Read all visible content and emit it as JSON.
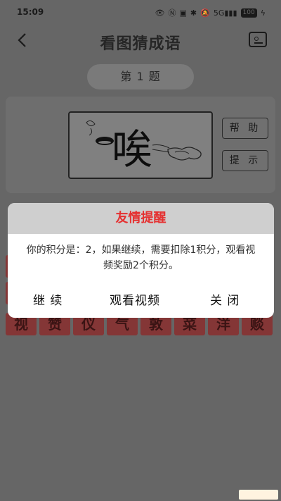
{
  "status_bar": {
    "time": "15:09",
    "signal": "5G",
    "battery": "100"
  },
  "header": {
    "title": "看图猜成语"
  },
  "level": {
    "label": "第 1 题"
  },
  "actions": {
    "help_label": "帮 助",
    "hint_label": "提 示"
  },
  "puzzle": {
    "glyph": "唉"
  },
  "char_grid": {
    "rows": [
      [
        "",
        "",
        "",
        "",
        "",
        "",
        "",
        ""
      ],
      [
        "",
        "",
        "",
        "",
        "",
        "",
        "",
        ""
      ],
      [
        "视",
        "赞",
        "仪",
        "气",
        "敦",
        "菜",
        "洋",
        "赕"
      ]
    ]
  },
  "dialog": {
    "title": "友情提醒",
    "message": "你的积分是：2，如果继续，需要扣除1积分，观看视频奖励2个积分。",
    "continue_label": "继 续",
    "watch_video_label": "观看视频",
    "close_label": "关 闭"
  },
  "colors": {
    "alert_title": "#e53030",
    "char_tile": "#843636",
    "backdrop": "#666666"
  }
}
